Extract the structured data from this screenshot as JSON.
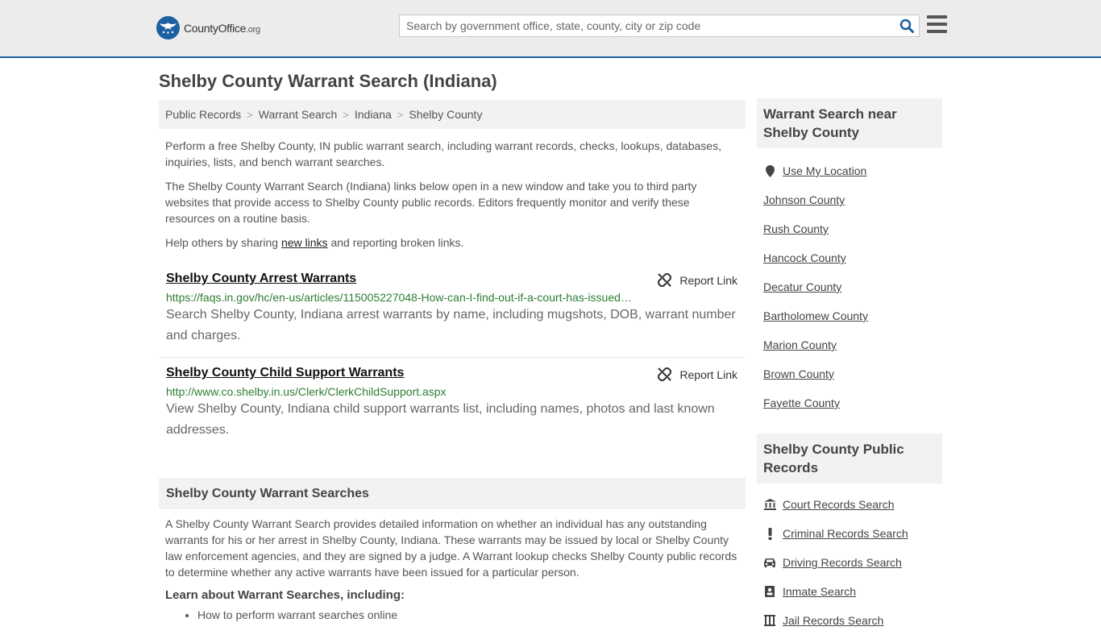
{
  "header": {
    "logo_county": "County",
    "logo_office": "Office",
    "logo_org": ".org",
    "search_placeholder": "Search by government office, state, county, city or zip code"
  },
  "page_title": "Shelby County Warrant Search (Indiana)",
  "breadcrumb": [
    {
      "label": "Public Records"
    },
    {
      "label": "Warrant Search"
    },
    {
      "label": "Indiana"
    },
    {
      "label": "Shelby County"
    }
  ],
  "intro": {
    "p1": "Perform a free Shelby County, IN public warrant search, including warrant records, checks, lookups, databases, inquiries, lists, and bench warrant searches.",
    "p2": "The Shelby County Warrant Search (Indiana) links below open in a new window and take you to third party websites that provide access to Shelby County public records. Editors frequently monitor and verify these resources on a routine basis.",
    "p3_before": "Help others by sharing ",
    "p3_link": "new links",
    "p3_after": " and reporting broken links."
  },
  "results": [
    {
      "title": "Shelby County Arrest Warrants",
      "report_label": "Report Link",
      "url": "https://faqs.in.gov/hc/en-us/articles/115005227048-How-can-I-find-out-if-a-court-has-issued-a-warrant-for-my-arrest-",
      "description": "Search Shelby County, Indiana arrest warrants by name, including mugshots, DOB, warrant number and charges."
    },
    {
      "title": "Shelby County Child Support Warrants",
      "report_label": "Report Link",
      "url": "http://www.co.shelby.in.us/Clerk/ClerkChildSupport.aspx",
      "description": "View Shelby County, Indiana child support warrants list, including names, photos and last known addresses."
    }
  ],
  "warrant_section": {
    "heading": "Shelby County Warrant Searches",
    "body": "A Shelby County Warrant Search provides detailed information on whether an individual has any outstanding warrants for his or her arrest in Shelby County, Indiana. These warrants may be issued by local or Shelby County law enforcement agencies, and they are signed by a judge. A Warrant lookup checks Shelby County public records to determine whether any active warrants have been issued for a particular person.",
    "learn_heading": "Learn about Warrant Searches, including:",
    "learn_items": [
      "How to perform warrant searches online"
    ]
  },
  "sidebar": {
    "nearby_heading": "Warrant Search near Shelby County",
    "use_location": "Use My Location",
    "nearby": [
      "Johnson County",
      "Rush County",
      "Hancock County",
      "Decatur County",
      "Bartholomew County",
      "Marion County",
      "Brown County",
      "Fayette County"
    ],
    "records_heading": "Shelby County Public Records",
    "records": [
      {
        "label": "Court Records Search",
        "icon": "courthouse-icon"
      },
      {
        "label": "Criminal Records Search",
        "icon": "exclamation-icon"
      },
      {
        "label": "Driving Records Search",
        "icon": "car-icon"
      },
      {
        "label": "Inmate Search",
        "icon": "inmate-badge-icon"
      },
      {
        "label": "Jail Records Search",
        "icon": "jail-icon"
      }
    ]
  },
  "colors": {
    "brand_blue": "#1d5fa0",
    "url_green": "#2e7d32",
    "panel_gray": "#f2f2f2"
  }
}
